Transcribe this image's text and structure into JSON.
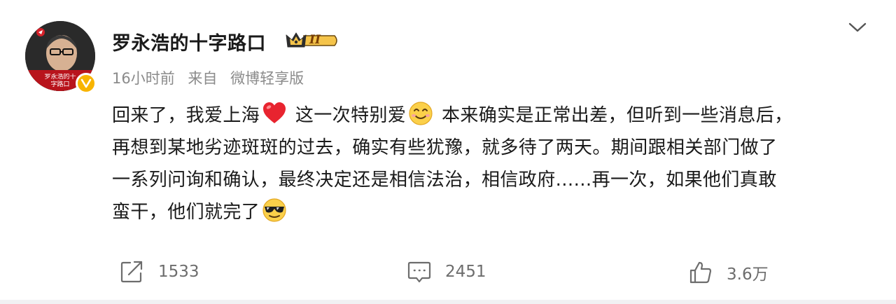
{
  "post": {
    "author": "罗永浩的十字路口",
    "avatar_caption": "罗永浩的十字路口",
    "vip_badge": "II",
    "meta": {
      "time": "16小时前",
      "source_prefix": "来自",
      "source": "微博轻享版"
    },
    "content_lines": [
      {
        "a": "回来了，我爱上海",
        "e1": "heart-emoji",
        "b": " 这一次特别爱",
        "e2": "smile-emoji",
        "c": " 本来确实是正常出差，但听到一些消息后，"
      },
      {
        "text": "再想到某地劣迹斑斑的过去，确实有些犹豫，就多待了两天。期间跟相关部门做了"
      },
      {
        "text": "一系列问询和确认，最终决定还是相信法治，相信政府......再一次，如果他们真敢"
      },
      {
        "a": "蛮干，他们就完了",
        "e1": "sunglasses-emoji"
      }
    ],
    "actions": {
      "forward_count": "1533",
      "comment_count": "2451",
      "like_count": "3.6万"
    }
  },
  "colors": {
    "text": "#1a1a1a",
    "meta": "#8b8b8b",
    "action": "#6d6d6d",
    "verified": "#f8b400",
    "avatar_banner": "#b8141c"
  },
  "icons": [
    "chevron-down-icon",
    "forward-icon",
    "comment-icon",
    "like-icon",
    "verified-icon",
    "crown-icon"
  ]
}
